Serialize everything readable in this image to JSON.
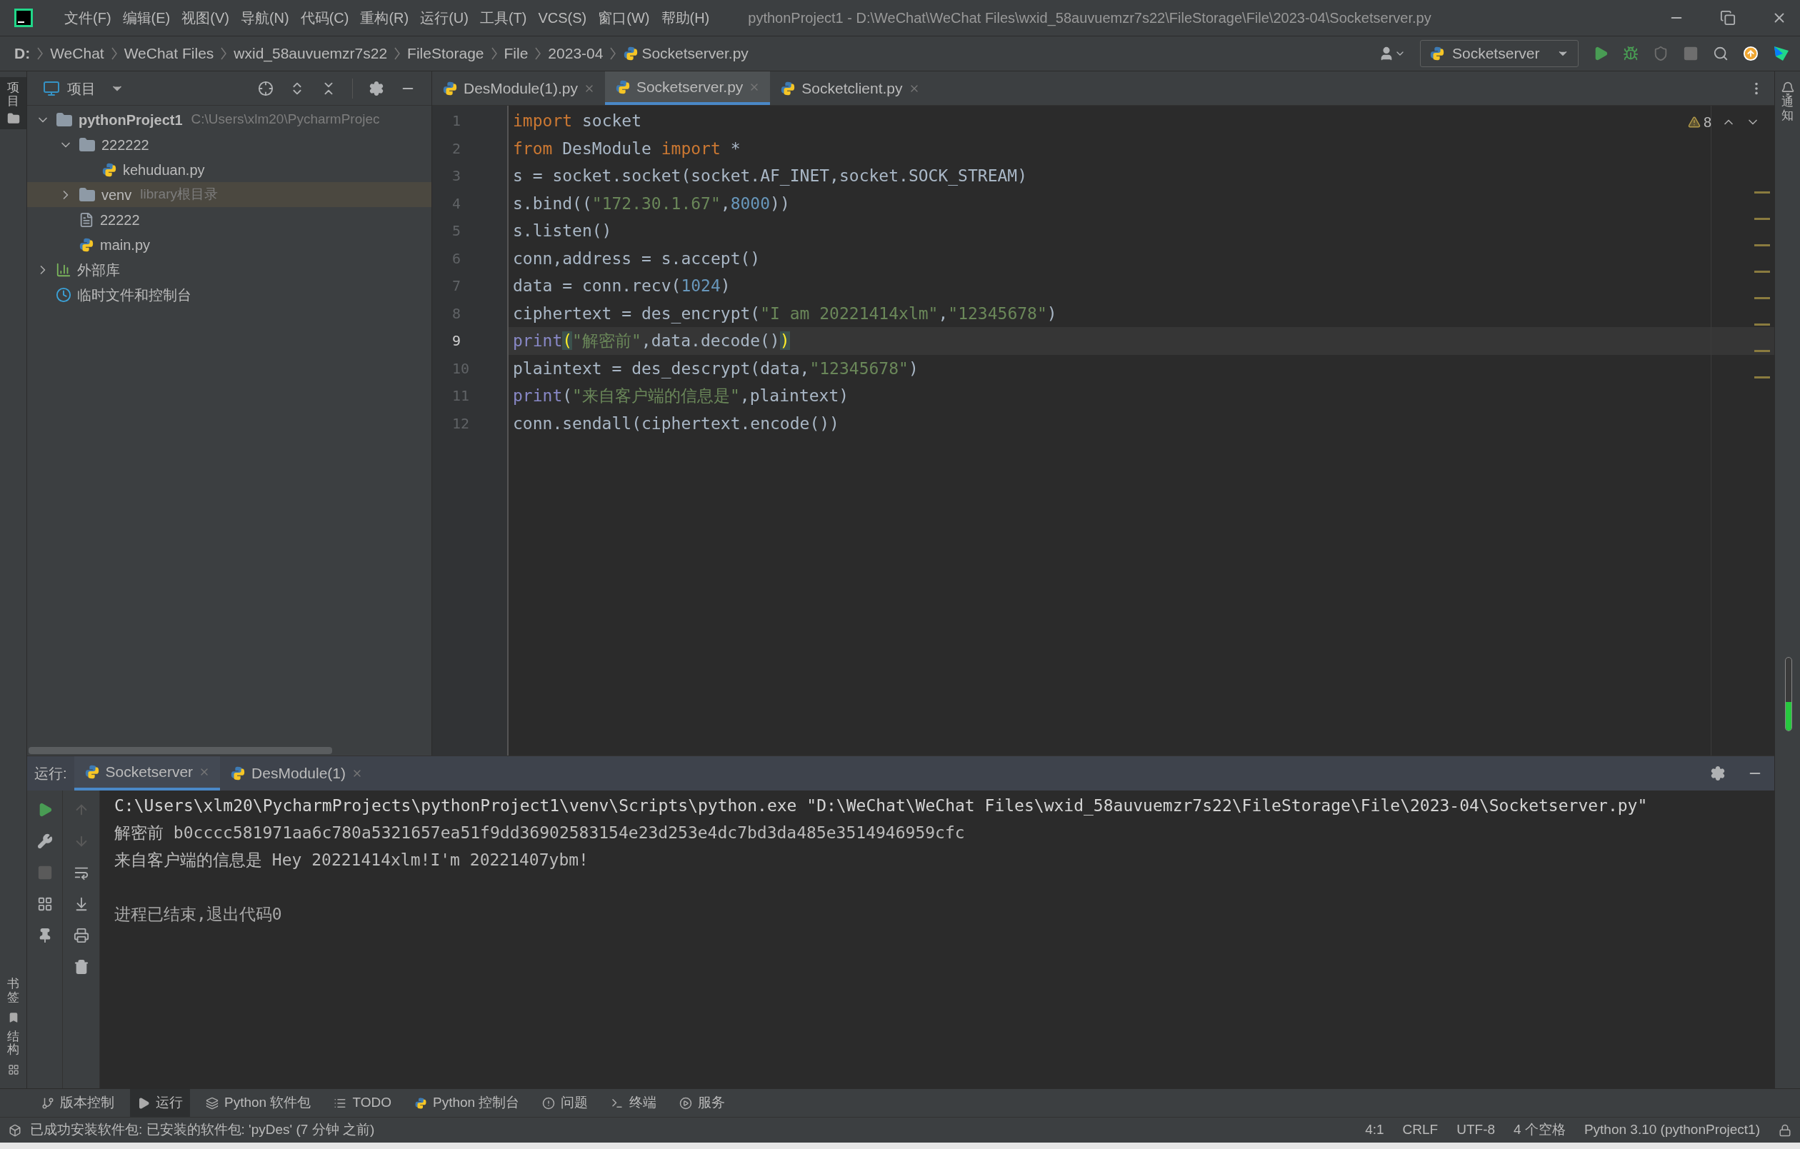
{
  "menu_bar": {
    "items": [
      "文件(F)",
      "编辑(E)",
      "视图(V)",
      "导航(N)",
      "代码(C)",
      "重构(R)",
      "运行(U)",
      "工具(T)",
      "VCS(S)",
      "窗口(W)",
      "帮助(H)"
    ]
  },
  "window": {
    "title": "pythonProject1 - D:\\WeChat\\WeChat Files\\wxid_58auvuemzr7s22\\FileStorage\\File\\2023-04\\Socketserver.py"
  },
  "breadcrumbs": [
    {
      "label": "D:",
      "kind": "drive"
    },
    {
      "label": "WeChat",
      "kind": "folder"
    },
    {
      "label": "WeChat Files",
      "kind": "folder"
    },
    {
      "label": "wxid_58auvuemzr7s22",
      "kind": "folder"
    },
    {
      "label": "FileStorage",
      "kind": "folder"
    },
    {
      "label": "File",
      "kind": "folder"
    },
    {
      "label": "2023-04",
      "kind": "folder"
    },
    {
      "label": "Socketserver.py",
      "kind": "python"
    }
  ],
  "toolbar": {
    "run_config": "Socketserver"
  },
  "side_labels": {
    "left_top": "项目",
    "left_bottom": [
      "书签",
      "结构"
    ],
    "right": "通知"
  },
  "project_panel": {
    "title": "项目",
    "tree": [
      {
        "label": "pythonProject1",
        "hint": "C:\\Users\\xlm20\\PycharmProjec",
        "kind": "project",
        "expanded": true,
        "selected": false,
        "children": [
          {
            "label": "222222",
            "kind": "folder",
            "expanded": true,
            "selected": false,
            "children": [
              {
                "label": "kehuduan.py",
                "kind": "python",
                "selected": false
              }
            ]
          },
          {
            "label": "venv",
            "hint": "library根目录",
            "kind": "folder",
            "expanded": false,
            "selected": true
          },
          {
            "label": "22222",
            "kind": "text",
            "selected": false
          },
          {
            "label": "main.py",
            "kind": "python",
            "selected": false
          }
        ]
      },
      {
        "label": "外部库",
        "kind": "library",
        "expanded": false,
        "selected": false
      },
      {
        "label": "临时文件和控制台",
        "kind": "scratch",
        "selected": false
      }
    ]
  },
  "editor": {
    "tabs": [
      {
        "label": "DesModule(1).py",
        "selected": false
      },
      {
        "label": "Socketserver.py",
        "selected": true
      },
      {
        "label": "Socketclient.py",
        "selected": false
      }
    ],
    "warnings": "8",
    "lines": [
      {
        "number": "1",
        "current": false,
        "tokens": [
          {
            "kind": "keyword",
            "text": "import"
          },
          {
            "kind": "plain",
            "text": " socket"
          }
        ]
      },
      {
        "number": "2",
        "current": false,
        "tokens": [
          {
            "kind": "keyword",
            "text": "from"
          },
          {
            "kind": "plain",
            "text": " DesModule "
          },
          {
            "kind": "keyword",
            "text": "import"
          },
          {
            "kind": "plain",
            "text": " *"
          }
        ]
      },
      {
        "number": "3",
        "current": false,
        "tokens": [
          {
            "kind": "plain",
            "text": "s = socket.socket(socket.AF_INET,socket.SOCK_STREAM)"
          }
        ]
      },
      {
        "number": "4",
        "current": false,
        "tokens": [
          {
            "kind": "plain",
            "text": "s.bind(("
          },
          {
            "kind": "string",
            "text": "\"172.30.1.67\""
          },
          {
            "kind": "plain",
            "text": ","
          },
          {
            "kind": "number",
            "text": "8000"
          },
          {
            "kind": "plain",
            "text": "))"
          }
        ]
      },
      {
        "number": "5",
        "current": false,
        "tokens": [
          {
            "kind": "plain",
            "text": "s.listen()"
          }
        ]
      },
      {
        "number": "6",
        "current": false,
        "tokens": [
          {
            "kind": "plain",
            "text": "conn,address = s.accept()"
          }
        ]
      },
      {
        "number": "7",
        "current": false,
        "tokens": [
          {
            "kind": "plain",
            "text": "data = conn.recv("
          },
          {
            "kind": "number",
            "text": "1024"
          },
          {
            "kind": "plain",
            "text": ")"
          }
        ]
      },
      {
        "number": "8",
        "current": false,
        "tokens": [
          {
            "kind": "plain",
            "text": "ciphertext = des_encrypt("
          },
          {
            "kind": "string",
            "text": "\"I am 20221414xlm\""
          },
          {
            "kind": "plain",
            "text": ","
          },
          {
            "kind": "string",
            "text": "\"12345678\""
          },
          {
            "kind": "plain",
            "text": ")"
          }
        ]
      },
      {
        "number": "9",
        "current": true,
        "tokens": [
          {
            "kind": "builtin",
            "text": "print"
          },
          {
            "kind": "brace",
            "text": "("
          },
          {
            "kind": "string",
            "text": "\"解密前\""
          },
          {
            "kind": "plain",
            "text": ",data.decode()"
          },
          {
            "kind": "brace",
            "text": ")"
          }
        ]
      },
      {
        "number": "10",
        "current": false,
        "tokens": [
          {
            "kind": "plain",
            "text": "plaintext = des_descrypt(data,"
          },
          {
            "kind": "string",
            "text": "\"12345678\""
          },
          {
            "kind": "plain",
            "text": ")"
          }
        ]
      },
      {
        "number": "11",
        "current": false,
        "tokens": [
          {
            "kind": "builtin",
            "text": "print"
          },
          {
            "kind": "plain",
            "text": "("
          },
          {
            "kind": "string",
            "text": "\"来自客户端的信息是\""
          },
          {
            "kind": "plain",
            "text": ",plaintext)"
          }
        ]
      },
      {
        "number": "12",
        "current": false,
        "tokens": [
          {
            "kind": "plain",
            "text": "conn.sendall(ciphertext.encode())"
          }
        ]
      }
    ]
  },
  "run_panel": {
    "label": "运行:",
    "tabs": [
      {
        "label": "Socketserver",
        "selected": true
      },
      {
        "label": "DesModule(1)",
        "selected": false
      }
    ],
    "output": [
      {
        "kind": "command",
        "text": "C:\\Users\\xlm20\\PycharmProjects\\pythonProject1\\venv\\Scripts\\python.exe \"D:\\WeChat\\WeChat Files\\wxid_58auvuemzr7s22\\FileStorage\\File\\2023-04\\Socketserver.py\""
      },
      {
        "kind": "output",
        "text": "解密前 b0cccc581971aa6c780a5321657ea51f9dd36902583154e23d253e4dc7bd3da485e3514946959cfc"
      },
      {
        "kind": "output",
        "text": "来自客户端的信息是 Hey 20221414xlm!I'm 20221407ybm!"
      },
      {
        "kind": "exit",
        "text": "进程已结束,退出代码0"
      }
    ]
  },
  "tool_windows": [
    {
      "label": "版本控制",
      "kind": "vcs",
      "selected": false
    },
    {
      "label": "运行",
      "kind": "run",
      "selected": true
    },
    {
      "label": "Python 软件包",
      "kind": "packages",
      "selected": false
    },
    {
      "label": "TODO",
      "kind": "todo",
      "selected": false
    },
    {
      "label": "Python 控制台",
      "kind": "console",
      "selected": false
    },
    {
      "label": "问题",
      "kind": "problems",
      "selected": false
    },
    {
      "label": "终端",
      "kind": "terminal",
      "selected": false
    },
    {
      "label": "服务",
      "kind": "services",
      "selected": false
    }
  ],
  "status_bar": {
    "message": "已成功安装软件包: 已安装的软件包: 'pyDes' (7 分钟 之前)",
    "items": [
      "4:1",
      "CRLF",
      "UTF-8",
      "4 个空格",
      "Python 3.10 (pythonProject1)"
    ]
  }
}
